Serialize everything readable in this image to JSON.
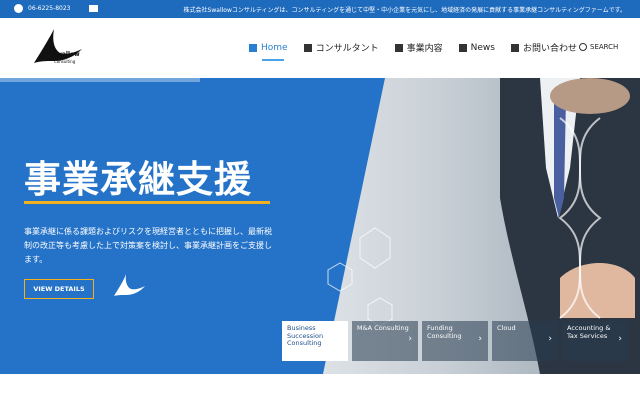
{
  "topbar": {
    "phone": "06-6225-8023",
    "tagline": "株式会社Swallowコンサルティングは、コンサルティングを通じて中堅・中小企業を元気にし、地域経済の発展に貢献する事業承継コンサルティングファームです。"
  },
  "logo": {
    "name": "Swallow",
    "sub": "Consulting"
  },
  "nav": {
    "items": [
      {
        "label": "Home",
        "icon": "home-icon"
      },
      {
        "label": "コンサルタント",
        "icon": "person-card-icon"
      },
      {
        "label": "事業内容",
        "icon": "briefcase-icon"
      },
      {
        "label": "News",
        "icon": "newspaper-icon"
      },
      {
        "label": "お問い合わせ",
        "icon": "phone-icon"
      }
    ],
    "search_label": "SEARCH"
  },
  "hero": {
    "title": "事業承継支援",
    "description": "事業承継に係る課題およびリスクを現経営者とともに把握し、最新税制の改正等も考慮した上で対策案を検討し、事業承継計画をご支援します。",
    "button_label": "VIEW DETAILS"
  },
  "cards": [
    {
      "label": "Business Succession Consulting"
    },
    {
      "label": "M&A Consulting"
    },
    {
      "label": "Funding Consulting"
    },
    {
      "label": "Cloud"
    },
    {
      "label": "Accounting & Tax Services"
    }
  ],
  "colors": {
    "primary": "#2473c8",
    "accent": "#f2b01e",
    "topbar": "#1e6bbd"
  }
}
